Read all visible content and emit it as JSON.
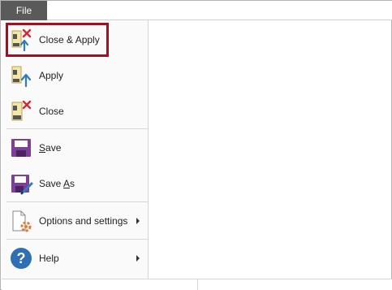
{
  "titlebar": {
    "file_tab": "File"
  },
  "menu": {
    "close_apply": "Close & Apply",
    "apply": "Apply",
    "close": "Close",
    "save_prefix": "",
    "save_underlined": "S",
    "save_rest": "ave",
    "saveas_prefix": "Save ",
    "saveas_underlined": "A",
    "saveas_rest": "s",
    "options": "Options and settings",
    "help": "Help"
  },
  "colors": {
    "file_tab_bg": "#5a5a5a",
    "highlight_border": "#a30f1e",
    "close_x": "#d9262e",
    "apply_arrow": "#2f7bbf",
    "save_purple": "#7e3f98",
    "help_blue": "#2f6fb3",
    "gear_orange": "#e07b39"
  },
  "icons": {
    "close_apply": "close-apply-icon",
    "apply": "apply-icon",
    "close": "close-icon",
    "save": "save-icon",
    "save_as": "save-as-icon",
    "options": "options-settings-icon",
    "help": "help-icon"
  }
}
